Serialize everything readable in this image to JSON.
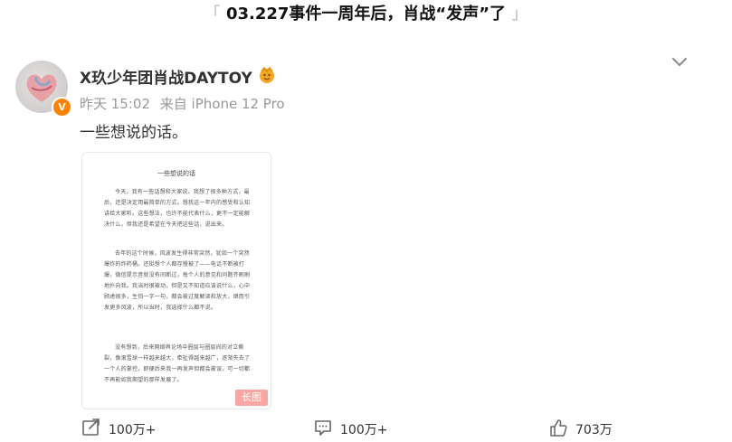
{
  "headline": {
    "left_bracket": "「",
    "text": "03.227事件一周年后，肖战“发声”了",
    "right_bracket": "」"
  },
  "post": {
    "user_name": "X玖少年团肖战DAYTOY",
    "verified_badge": "V",
    "time": "昨天 15:02",
    "source": "来自 iPhone 12 Pro",
    "text": "一些想说的话。",
    "long_image_tag": "长图",
    "document": {
      "title": "一些想说的话",
      "paragraphs": [
        "今天，我有一些话想和大家说。我想了很多种方式，最后，还是决定用最简单的方式。想我这一年内的感受和认知讲给大家听。这些想法，也许不能代表什么，更不一定能解决什么，但我还是希望在今天把这些话，说出来。",
        "去年的这个时候，风波发生得非常突然，犹如一个突然爆炸的炸药桶。还挺想个人都存慢被了——电话不断被打爆，微信提示音就没有间断过，每个人的意见和问题齐刷刷地扑向我。我当时很被动，但是又不知道应该说什么，心中顾虑很多，生怕一字一句，都会被过度解读和放大，继而引发更多风波，所以当时，我选择什么都不说。",
        "没有想到，后来网络舆论场中圈层与圈层间的对立撕裂，像滚雪球一样越来越大，牵扯得越来越广，逐渐失去了一个人的掌控。即便后来我一再发声但都会被误，可一切都不再能如我期望的那样发展了。"
      ]
    },
    "actions": {
      "repost_count": "100万+",
      "comment_count": "100万+",
      "like_count": "703万"
    }
  }
}
